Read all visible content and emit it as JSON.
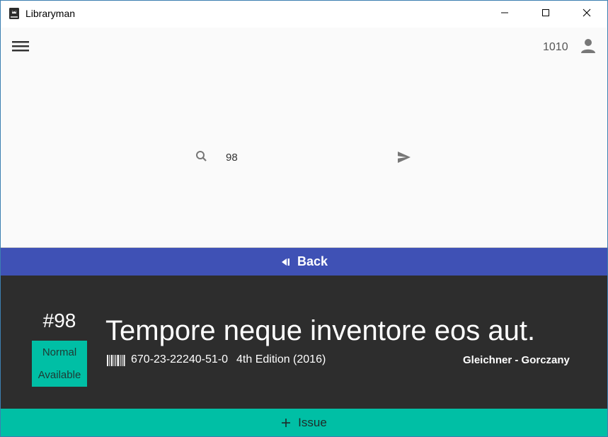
{
  "window": {
    "title": "Libraryman",
    "icon": "book-icon",
    "controls": [
      "minimize-icon",
      "maximize-icon",
      "close-icon"
    ]
  },
  "appbar": {
    "menu_icon": "hamburger-menu-icon",
    "user_id": "1010",
    "account_icon": "account-icon"
  },
  "search": {
    "icon": "search-icon",
    "value": "98",
    "send_icon": "send-icon"
  },
  "back": {
    "label": "Back",
    "icon": "back-icon",
    "color": "#3f51b5"
  },
  "book": {
    "number": "#98",
    "type": "Normal",
    "availability": "Available",
    "title": "Tempore neque inventore eos aut.",
    "isbn": "670-23-22240-51-0",
    "edition": "4th Edition (2016)",
    "publisher": "Gleichner - Gorczany",
    "barcode_icon": "barcode-icon",
    "panel_color": "#2d2d2d",
    "status_color": "#00bfa5"
  },
  "issue": {
    "label": "Issue",
    "icon": "plus-icon",
    "color": "#00bfa5"
  }
}
